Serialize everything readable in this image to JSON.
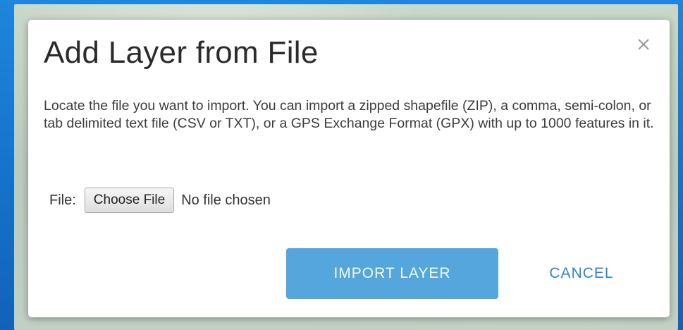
{
  "dialog": {
    "title": "Add Layer from File",
    "close_icon": "close-icon",
    "description": "Locate the file you want to import. You can import a zipped shapefile (ZIP), a comma, semi-colon, or tab delimited text file (CSV or TXT), or a GPS Exchange Format (GPX) with up to 1000 features in it.",
    "file_label": "File:",
    "choose_file_label": "Choose File",
    "file_status": "No file chosen",
    "import_label": "IMPORT LAYER",
    "cancel_label": "CANCEL"
  },
  "colors": {
    "primary_button": "#55a6dc",
    "cancel_text": "#2f86c8",
    "frame": "#1a78d0"
  }
}
